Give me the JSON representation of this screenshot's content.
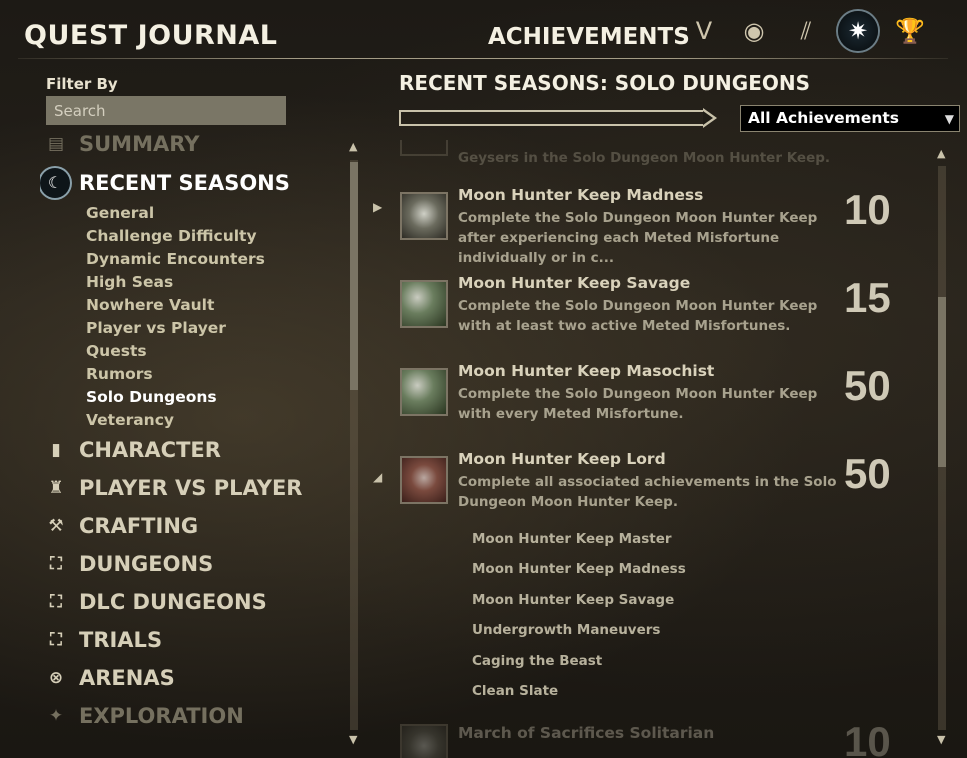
{
  "header": {
    "title": "QUEST JOURNAL",
    "section": "ACHIEVEMENTS",
    "tabs": [
      {
        "icon": "champion-icon",
        "glyph": "V"
      },
      {
        "icon": "eye-icon",
        "glyph": "◉"
      },
      {
        "icon": "collections-icon",
        "glyph": "⫽"
      },
      {
        "icon": "star-emblem-icon",
        "glyph": "✷"
      },
      {
        "icon": "trophy-icon",
        "glyph": "🏆"
      }
    ]
  },
  "filter": {
    "label": "Filter By",
    "placeholder": "Search"
  },
  "nav": {
    "summary": {
      "label": "SUMMARY",
      "icon": "summary-icon"
    },
    "recent_seasons": {
      "label": "RECENT SEASONS",
      "icon": "seasons-icon"
    },
    "subcategories": [
      "General",
      "Challenge Difficulty",
      "Dynamic Encounters",
      "High Seas",
      "Nowhere Vault",
      "Player vs Player",
      "Quests",
      "Rumors",
      "Solo Dungeons",
      "Veterancy"
    ],
    "selected_sub": "Solo Dungeons",
    "categories": [
      {
        "label": "CHARACTER",
        "icon": "bookmark-icon",
        "glyph": "▮"
      },
      {
        "label": "PLAYER VS PLAYER",
        "icon": "tower-icon",
        "glyph": "♜"
      },
      {
        "label": "CRAFTING",
        "icon": "hammer-icon",
        "glyph": "⚒"
      },
      {
        "label": "DUNGEONS",
        "icon": "dungeon-icon",
        "glyph": "⛶"
      },
      {
        "label": "DLC DUNGEONS",
        "icon": "dlc-dungeon-icon",
        "glyph": "⛶"
      },
      {
        "label": "TRIALS",
        "icon": "trials-icon",
        "glyph": "⛶"
      },
      {
        "label": "ARENAS",
        "icon": "arenas-icon",
        "glyph": "⊗"
      },
      {
        "label": "EXPLORATION",
        "icon": "exploration-icon",
        "glyph": "✦"
      }
    ]
  },
  "content": {
    "title": "RECENT SEASONS: SOLO DUNGEONS",
    "dropdown": "All Achievements",
    "partial_top_text": "Geysers in the Solo Dungeon Moon Hunter Keep.",
    "achievements": [
      {
        "name": "Moon Hunter Keep Madness",
        "desc": "Complete the Solo Dungeon Moon Hunter Keep after experiencing each Meted Misfortune individually or in c...",
        "points": "10"
      },
      {
        "name": "Moon Hunter Keep Savage",
        "desc": "Complete the Solo Dungeon Moon Hunter Keep with at least two active Meted Misfortunes.",
        "points": "15"
      },
      {
        "name": "Moon Hunter Keep Masochist",
        "desc": "Complete the Solo Dungeon Moon Hunter Keep with every Meted Misfortune.",
        "points": "50"
      },
      {
        "name": "Moon Hunter Keep Lord",
        "desc": "Complete all associated achievements in the Solo Dungeon Moon Hunter Keep.",
        "points": "50",
        "sub": [
          "Moon Hunter Keep Master",
          "Moon Hunter Keep Madness",
          "Moon Hunter Keep Savage",
          "Undergrowth Maneuvers",
          "Caging the Beast",
          "Clean Slate"
        ]
      }
    ],
    "partial_bottom": {
      "name": "March of Sacrifices Solitarian",
      "points": "10"
    }
  }
}
